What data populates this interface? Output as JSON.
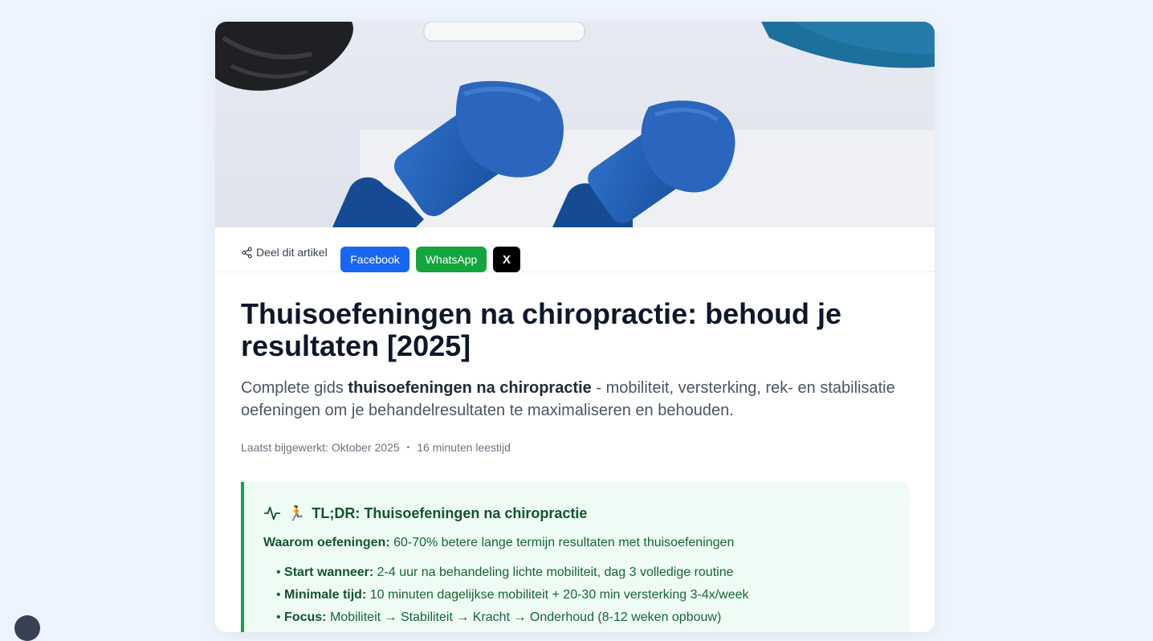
{
  "share": {
    "label": "Deel dit artikel",
    "facebook": "Facebook",
    "whatsapp": "WhatsApp",
    "x": "X"
  },
  "article": {
    "title": "Thuisoefeningen na chiropractie: behoud je resultaten [2025]",
    "lead_prefix": "Complete gids ",
    "lead_bold": "thuisoefeningen na chiropractie",
    "lead_suffix": " - mobiliteit, versterking, rek- en stabilisatie oefeningen om je behandelresultaten te maximaliseren en behouden.",
    "updated": "Laatst bijgewerkt: Oktober 2025",
    "separator": "•",
    "read_time": "16 minuten leestijd"
  },
  "tldr": {
    "emoji": "🏃",
    "heading": "TL;DR: Thuisoefeningen na chiropractie",
    "why_label": "Waarom oefeningen:",
    "why_text": " 60-70% betere lange termijn resultaten met thuisoefeningen",
    "items": [
      {
        "bullet": "• ",
        "label": "Start wanneer:",
        "text": " 2-4 uur na behandeling lichte mobiliteit, dag 3 volledige routine"
      },
      {
        "bullet": "• ",
        "label": "Minimale tijd:",
        "text": " 10 minuten dagelijkse mobiliteit + 20-30 min versterking 3-4x/week"
      },
      {
        "bullet": "• ",
        "label": "Focus:",
        "text": " Mobiliteit → Stabiliteit → Kracht → Onderhoud (8-12 weken opbouw)"
      }
    ]
  },
  "colors": {
    "facebook": "#1867f2",
    "whatsapp": "#14a53c",
    "x": "#000000",
    "tldr_accent": "#16a34a",
    "page_bg": "#eef4fd"
  },
  "icons": {
    "share": "share-icon",
    "activity": "activity-icon"
  }
}
